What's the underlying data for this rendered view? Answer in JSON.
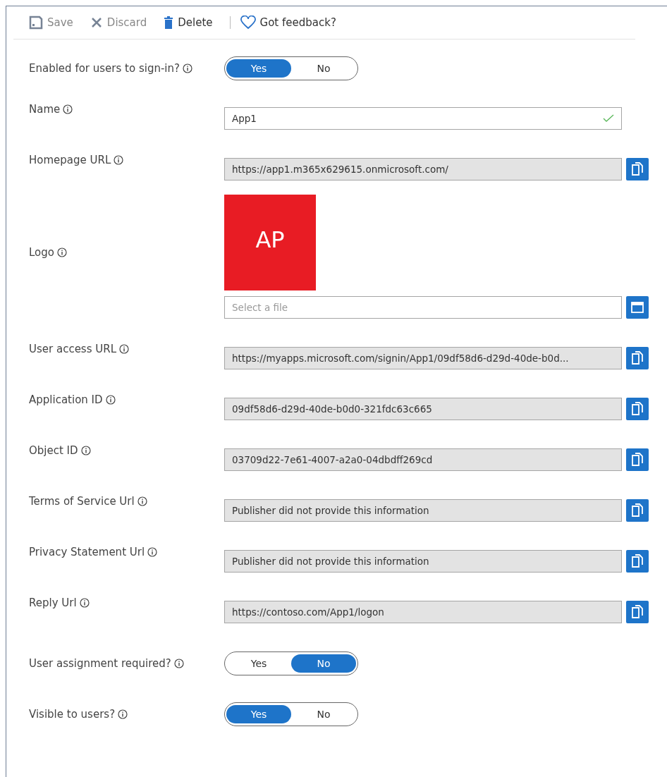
{
  "toolbar": [
    {
      "kind": "save",
      "label": "Save",
      "disabled": true,
      "separator_before": false
    },
    {
      "kind": "discard",
      "label": "Discard",
      "disabled": true,
      "separator_before": false
    },
    {
      "kind": "delete",
      "label": "Delete",
      "disabled": false,
      "separator_before": false
    },
    {
      "kind": "feedback",
      "label": "Got feedback?",
      "disabled": false,
      "separator_before": true
    }
  ],
  "fields": [
    {
      "kind": "toggle",
      "label": "Enabled for users to sign-in?",
      "options": [
        {
          "label": "Yes",
          "selected": true
        },
        {
          "label": "No",
          "selected": false
        }
      ]
    },
    {
      "kind": "text",
      "label": "Name",
      "value": "App1",
      "valid": true
    },
    {
      "kind": "readonly",
      "label": "Homepage URL",
      "value": "https://app1.m365x629615.onmicrosoft.com/"
    },
    {
      "kind": "logo",
      "label": "Logo",
      "logo_text": "AP",
      "placeholder": "Select a file"
    },
    {
      "kind": "readonly",
      "label": "User access URL",
      "value": "https://myapps.microsoft.com/signin/App1/09df58d6-d29d-40de-b0d..."
    },
    {
      "kind": "readonly",
      "label": "Application ID",
      "value": "09df58d6-d29d-40de-b0d0-321fdc63c665"
    },
    {
      "kind": "readonly",
      "label": "Object ID",
      "value": "03709d22-7e61-4007-a2a0-04dbdff269cd"
    },
    {
      "kind": "readonly",
      "label": "Terms of Service Url",
      "value": "Publisher did not provide this information"
    },
    {
      "kind": "readonly",
      "label": "Privacy Statement Url",
      "value": "Publisher did not provide this information"
    },
    {
      "kind": "readonly",
      "label": "Reply Url",
      "value": "https://contoso.com/App1/logon"
    },
    {
      "kind": "toggle",
      "label": "User assignment required?",
      "options": [
        {
          "label": "Yes",
          "selected": false
        },
        {
          "label": "No",
          "selected": true
        }
      ]
    },
    {
      "kind": "toggle",
      "label": "Visible to users?",
      "options": [
        {
          "label": "Yes",
          "selected": true
        },
        {
          "label": "No",
          "selected": false
        }
      ]
    }
  ]
}
